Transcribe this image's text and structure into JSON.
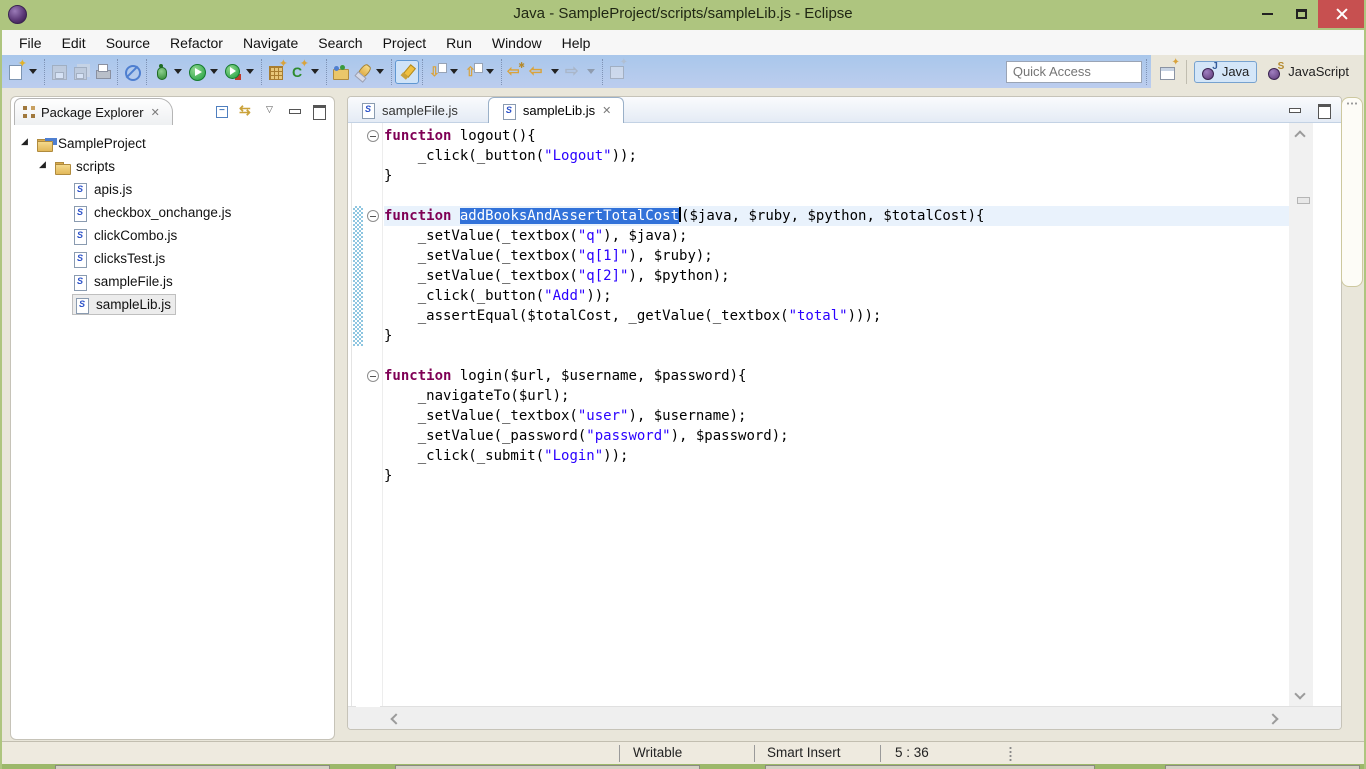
{
  "window": {
    "title": "Java - SampleProject/scripts/sampleLib.js - Eclipse"
  },
  "menu": {
    "items": [
      "File",
      "Edit",
      "Source",
      "Refactor",
      "Navigate",
      "Search",
      "Project",
      "Run",
      "Window",
      "Help"
    ]
  },
  "toolbar": {
    "groups": [
      {
        "buttons": [
          {
            "name": "new-wizard",
            "dropdown": true
          }
        ]
      },
      {
        "buttons": [
          {
            "name": "save",
            "disabled": true
          },
          {
            "name": "save-all",
            "disabled": true
          },
          {
            "name": "print"
          }
        ]
      },
      {
        "buttons": [
          {
            "name": "skip-all-breakpoints"
          }
        ]
      },
      {
        "buttons": [
          {
            "name": "debug",
            "dropdown": true
          },
          {
            "name": "run",
            "dropdown": true
          },
          {
            "name": "run-coverage",
            "dropdown": true
          }
        ]
      },
      {
        "buttons": [
          {
            "name": "new-java-project"
          },
          {
            "name": "new-class",
            "dropdown": true
          }
        ]
      },
      {
        "buttons": [
          {
            "name": "open-task"
          },
          {
            "name": "search",
            "dropdown": true
          }
        ]
      },
      {
        "buttons": [
          {
            "name": "mark-occurrences",
            "active": true
          }
        ]
      },
      {
        "buttons": [
          {
            "name": "next-annotation",
            "dropdown": true
          },
          {
            "name": "previous-annotation",
            "dropdown": true
          }
        ]
      },
      {
        "buttons": [
          {
            "name": "last-edit-location"
          },
          {
            "name": "back",
            "dropdown": true
          },
          {
            "name": "forward",
            "disabled": true,
            "dropdown": true
          }
        ]
      },
      {
        "buttons": [
          {
            "name": "pin-editor",
            "disabled": true
          }
        ]
      }
    ],
    "quick_access": {
      "placeholder": "Quick Access"
    },
    "perspectives": [
      {
        "label": "Java",
        "icon": "java-perspective-icon",
        "active": true
      },
      {
        "label": "JavaScript",
        "icon": "javascript-perspective-icon",
        "active": false
      }
    ]
  },
  "package_explorer": {
    "title": "Package Explorer",
    "toolbar_icons": [
      "collapse-all",
      "link-with-editor",
      "view-menu",
      "minimize-view",
      "maximize-view"
    ],
    "tree": [
      {
        "label": "SampleProject",
        "depth": 0,
        "icon": "js-project",
        "expanded": true
      },
      {
        "label": "scripts",
        "depth": 1,
        "icon": "folder",
        "expanded": true
      },
      {
        "label": "apis.js",
        "depth": 2,
        "icon": "js-file"
      },
      {
        "label": "checkbox_onchange.js",
        "depth": 2,
        "icon": "js-file"
      },
      {
        "label": "clickCombo.js",
        "depth": 2,
        "icon": "js-file"
      },
      {
        "label": "clicksTest.js",
        "depth": 2,
        "icon": "js-file"
      },
      {
        "label": "sampleFile.js",
        "depth": 2,
        "icon": "js-file"
      },
      {
        "label": "sampleLib.js",
        "depth": 2,
        "icon": "js-file",
        "selected": true
      }
    ]
  },
  "editor": {
    "tabs": [
      {
        "label": "sampleFile.js",
        "active": false,
        "closable": false
      },
      {
        "label": "sampleLib.js",
        "active": true,
        "closable": true
      }
    ],
    "code": {
      "lines": [
        {
          "fold": true,
          "segs": [
            [
              "k",
              "function"
            ],
            [
              "p",
              " logout(){"
            ]
          ]
        },
        {
          "segs": [
            [
              "p",
              "    _click(_button("
            ],
            [
              "s",
              "\"Logout\""
            ],
            [
              "p",
              "));"
            ]
          ]
        },
        {
          "segs": [
            [
              "p",
              "}"
            ]
          ]
        },
        {
          "segs": []
        },
        {
          "fold": true,
          "current": true,
          "changed": true,
          "segs": [
            [
              "k",
              "function"
            ],
            [
              "p",
              " "
            ],
            [
              "sel",
              "addBooksAndAssertTotalCost"
            ],
            [
              "caret",
              ""
            ],
            [
              "p",
              "($java, $ruby, $python, $totalCost){"
            ]
          ]
        },
        {
          "changed": true,
          "segs": [
            [
              "p",
              "    _setValue(_textbox("
            ],
            [
              "s",
              "\"q\""
            ],
            [
              "p",
              "), $java);"
            ]
          ]
        },
        {
          "changed": true,
          "segs": [
            [
              "p",
              "    _setValue(_textbox("
            ],
            [
              "s",
              "\"q[1]\""
            ],
            [
              "p",
              "), $ruby);"
            ]
          ]
        },
        {
          "changed": true,
          "segs": [
            [
              "p",
              "    _setValue(_textbox("
            ],
            [
              "s",
              "\"q[2]\""
            ],
            [
              "p",
              "), $python);"
            ]
          ]
        },
        {
          "changed": true,
          "segs": [
            [
              "p",
              "    _click(_button("
            ],
            [
              "s",
              "\"Add\""
            ],
            [
              "p",
              "));"
            ]
          ]
        },
        {
          "changed": true,
          "segs": [
            [
              "p",
              "    _assertEqual($totalCost, _getValue(_textbox("
            ],
            [
              "s",
              "\"total\""
            ],
            [
              "p",
              ")));"
            ]
          ]
        },
        {
          "changed": true,
          "segs": [
            [
              "p",
              "}"
            ]
          ]
        },
        {
          "segs": []
        },
        {
          "fold": true,
          "segs": [
            [
              "k",
              "function"
            ],
            [
              "p",
              " login($url, $username, $password){"
            ]
          ]
        },
        {
          "segs": [
            [
              "p",
              "    _navigateTo($url);"
            ]
          ]
        },
        {
          "segs": [
            [
              "p",
              "    _setValue(_textbox("
            ],
            [
              "s",
              "\"user\""
            ],
            [
              "p",
              "), $username);"
            ]
          ]
        },
        {
          "segs": [
            [
              "p",
              "    _setValue(_password("
            ],
            [
              "s",
              "\"password\""
            ],
            [
              "p",
              "), $password);"
            ]
          ]
        },
        {
          "segs": [
            [
              "p",
              "    _click(_submit("
            ],
            [
              "s",
              "\"Login\""
            ],
            [
              "p",
              "));"
            ]
          ]
        },
        {
          "segs": [
            [
              "p",
              "}"
            ]
          ]
        }
      ]
    }
  },
  "right_trim": {
    "icons": [
      "restore-views",
      "outline-view",
      "javadoc-view",
      "declaration-view"
    ]
  },
  "status_bar": {
    "writable": "Writable",
    "insert_mode": "Smart Insert",
    "cursor_position": "5 : 36"
  },
  "colors": {
    "titlebar": "#aec57f",
    "toolbar_top": "#a9c7eb",
    "toolbar_bottom": "#bccdee",
    "selection": "#3272d9",
    "keyword": "#7f0055",
    "string": "#2a00ff",
    "current_line": "#e9f2fc",
    "close_button": "#c75050"
  }
}
